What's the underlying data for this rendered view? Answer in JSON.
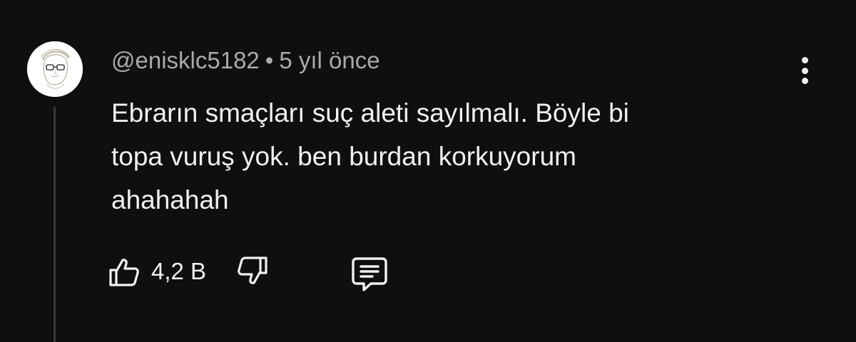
{
  "comment": {
    "author": "@enisklc5182",
    "separator": "•",
    "time": "5 yıl önce",
    "text_lines": [
      "Ebrarın smaçları suç aleti sayılmalı. Böyle bi",
      "topa vuruş yok. ben burdan korkuyorum",
      "ahahahah"
    ],
    "like_count": "4,2 B"
  },
  "icons": {
    "avatar": "avatar-sketch",
    "like": "thumbs-up-icon",
    "dislike": "thumbs-down-icon",
    "reply": "comment-icon",
    "more": "more-vertical-icon"
  },
  "colors": {
    "background": "#0f0f0f",
    "primary_text": "#f1f1f1",
    "secondary_text": "#aaaaaa",
    "thread_line": "#3a3a3a"
  }
}
